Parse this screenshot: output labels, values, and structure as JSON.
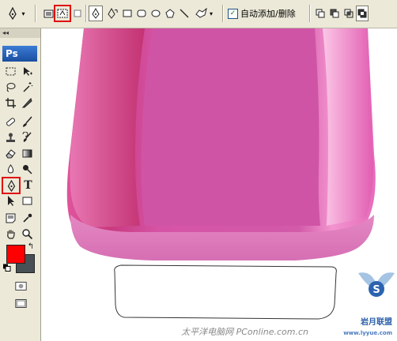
{
  "options_bar": {
    "auto_add_delete_label": "自动添加/删除",
    "auto_add_delete_checked": true,
    "icons": [
      "pen-tool-icon",
      "shape-layers-icon",
      "paths-icon",
      "fill-pixels-icon",
      "pen-icon",
      "freeform-pen-icon",
      "rectangle-icon",
      "rounded-rectangle-icon",
      "ellipse-icon",
      "polygon-icon",
      "line-icon",
      "custom-shape-icon",
      "add-to-area-icon",
      "subtract-icon",
      "intersect-icon",
      "exclude-icon"
    ]
  },
  "toolbox": {
    "logo": "Ps",
    "type_tool_label": "T",
    "foreground_color": "#ff0000",
    "background_color": "#465055"
  },
  "canvas": {
    "bottle_color": "#d45aa8",
    "cap_highlight": "#e98cc6"
  },
  "watermark": {
    "text": "太平洋电脑网 PConline.com.cn",
    "logo_text": "岩月联盟",
    "logo_sub": "www.lyyue.com"
  }
}
